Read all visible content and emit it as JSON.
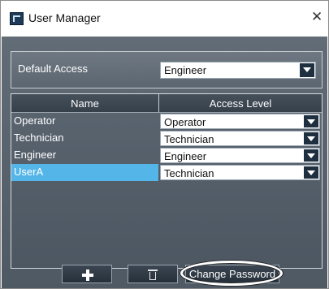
{
  "window": {
    "title": "User Manager",
    "close_glyph": "✕",
    "app_icon": "user-manager-app-icon"
  },
  "default_access": {
    "label": "Default Access",
    "value": "Engineer"
  },
  "table": {
    "columns": [
      "Name",
      "Access Level"
    ],
    "rows": [
      {
        "name": "Operator",
        "access": "Operator",
        "selected": false
      },
      {
        "name": "Technician",
        "access": "Technician",
        "selected": false
      },
      {
        "name": "Engineer",
        "access": "Engineer",
        "selected": false
      },
      {
        "name": "UserA",
        "access": "Technician",
        "selected": true
      }
    ]
  },
  "buttons": {
    "add_icon": "plus-icon",
    "delete_icon": "trash-icon",
    "change_password": "Change Password"
  },
  "colors": {
    "selection": "#54b6e8",
    "panel": "#5f6a76",
    "dropdown_button": "#1e2f40"
  }
}
